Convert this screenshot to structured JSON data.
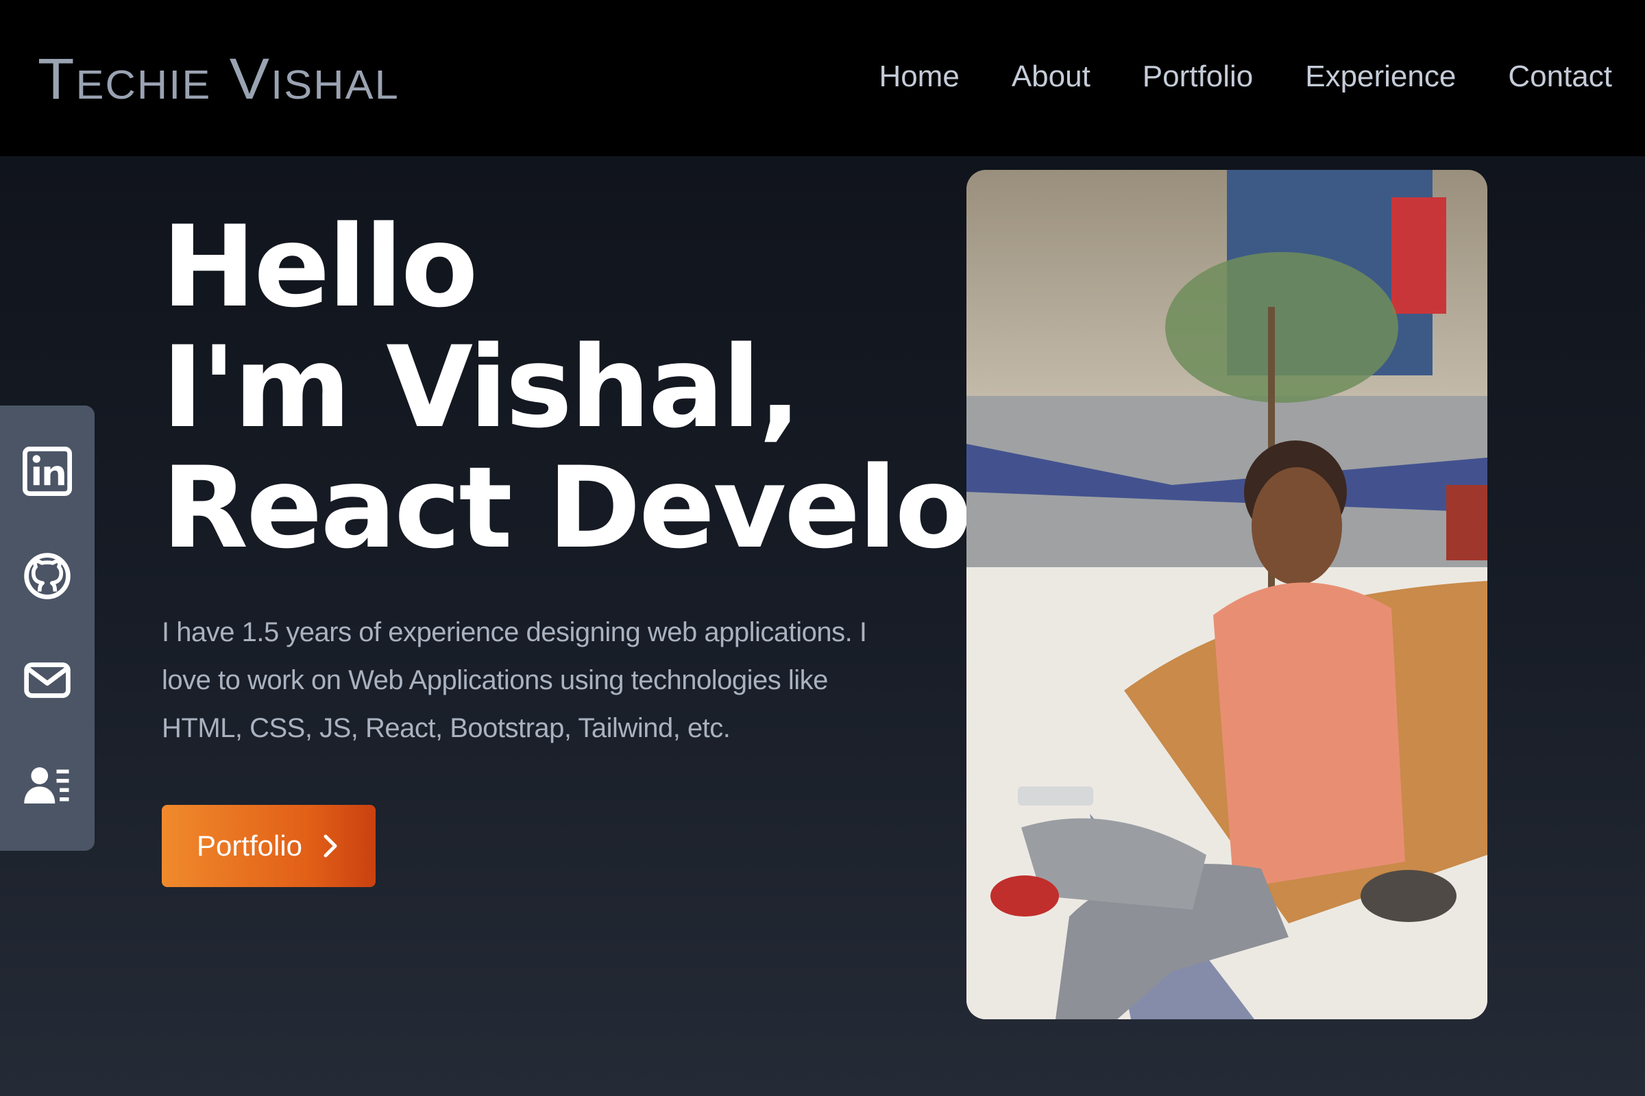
{
  "brand": {
    "logo_text": "Techie Vishal"
  },
  "nav": {
    "items": [
      "Home",
      "About",
      "Portfolio",
      "Experience",
      "Contact"
    ]
  },
  "social": {
    "icons": [
      "linkedin-icon",
      "github-icon",
      "mail-icon",
      "resume-icon"
    ]
  },
  "hero": {
    "line1": "Hello",
    "line2": "I'm Vishal,",
    "line3": "React Developer.",
    "description": "I have 1.5 years of experience designing web applications. I love to work on Web Applications using technologies like HTML, CSS, JS, React, Bootstrap, Tailwind, etc.",
    "cta_label": "Portfolio",
    "cta_icon": "chevron-right-icon"
  },
  "colors": {
    "nav_bg": "#000000",
    "logo": "#9aa3b2",
    "nav_link": "#c5ccd8",
    "social_bar": "#4b5566",
    "cta_start": "#f08a2c",
    "cta_end": "#c94110"
  }
}
